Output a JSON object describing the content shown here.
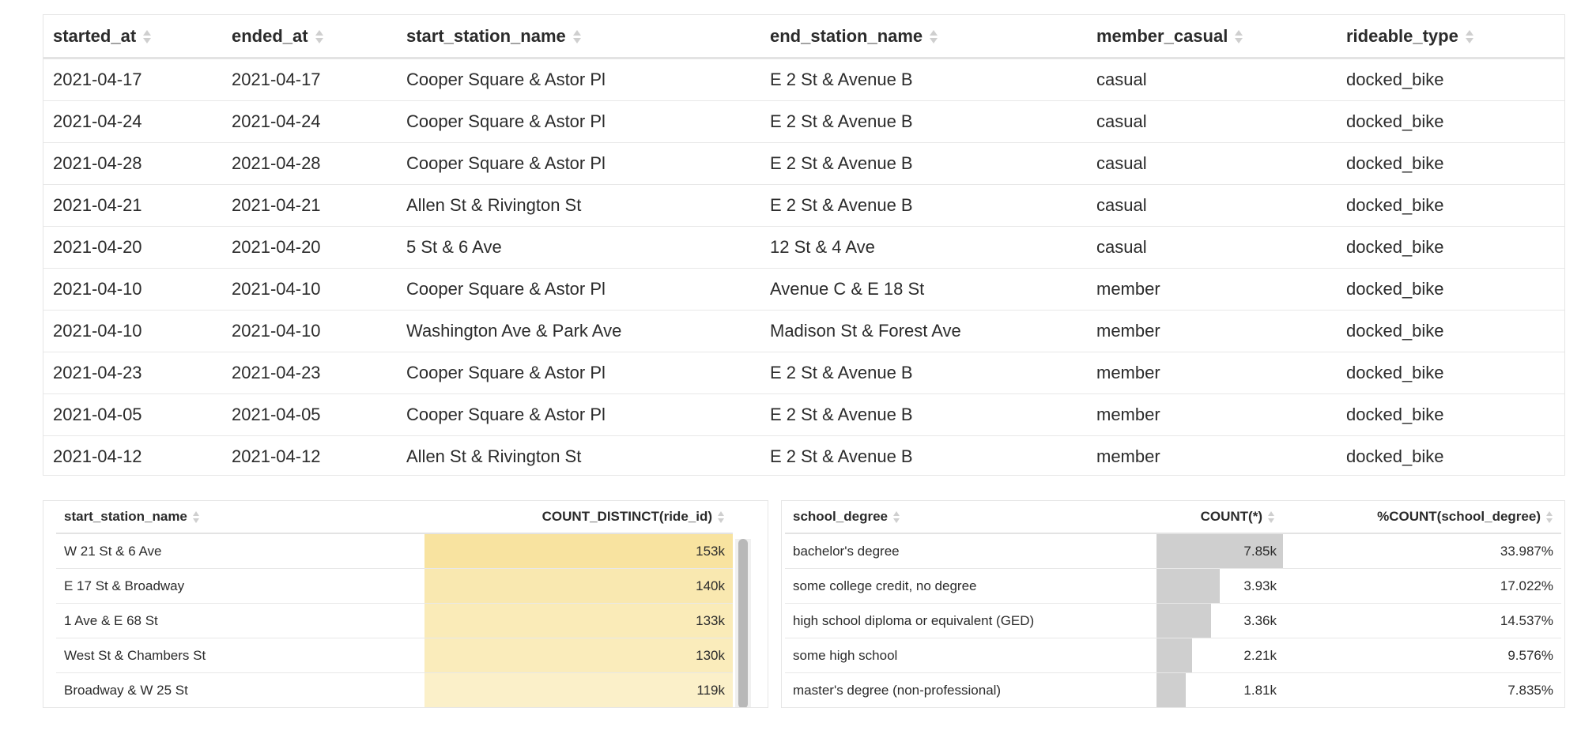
{
  "rides_table": {
    "columns": [
      "started_at",
      "ended_at",
      "start_station_name",
      "end_station_name",
      "member_casual",
      "rideable_type"
    ],
    "rows": [
      [
        "2021-04-17",
        "2021-04-17",
        "Cooper Square & Astor Pl",
        "E 2 St & Avenue B",
        "casual",
        "docked_bike"
      ],
      [
        "2021-04-24",
        "2021-04-24",
        "Cooper Square & Astor Pl",
        "E 2 St & Avenue B",
        "casual",
        "docked_bike"
      ],
      [
        "2021-04-28",
        "2021-04-28",
        "Cooper Square & Astor Pl",
        "E 2 St & Avenue B",
        "casual",
        "docked_bike"
      ],
      [
        "2021-04-21",
        "2021-04-21",
        "Allen St & Rivington St",
        "E 2 St & Avenue B",
        "casual",
        "docked_bike"
      ],
      [
        "2021-04-20",
        "2021-04-20",
        "5 St & 6 Ave",
        "12 St & 4 Ave",
        "casual",
        "docked_bike"
      ],
      [
        "2021-04-10",
        "2021-04-10",
        "Cooper Square & Astor Pl",
        "Avenue C & E 18 St",
        "member",
        "docked_bike"
      ],
      [
        "2021-04-10",
        "2021-04-10",
        "Washington Ave & Park Ave",
        "Madison St & Forest Ave",
        "member",
        "docked_bike"
      ],
      [
        "2021-04-23",
        "2021-04-23",
        "Cooper Square & Astor Pl",
        "E 2 St & Avenue B",
        "member",
        "docked_bike"
      ],
      [
        "2021-04-05",
        "2021-04-05",
        "Cooper Square & Astor Pl",
        "E 2 St & Avenue B",
        "member",
        "docked_bike"
      ],
      [
        "2021-04-12",
        "2021-04-12",
        "Allen St & Rivington St",
        "E 2 St & Avenue B",
        "member",
        "docked_bike"
      ]
    ]
  },
  "station_counts": {
    "columns": [
      "start_station_name",
      "COUNT_DISTINCT(ride_id)"
    ],
    "rows": [
      {
        "name": "W 21 St & 6 Ave",
        "value": "153k",
        "fill": 1.0,
        "color": "#f8e3a0"
      },
      {
        "name": "E 17 St & Broadway",
        "value": "140k",
        "fill": 1.0,
        "color": "#f9e8b0"
      },
      {
        "name": "1 Ave & E 68 St",
        "value": "133k",
        "fill": 1.0,
        "color": "#faebb8"
      },
      {
        "name": "West St & Chambers St",
        "value": "130k",
        "fill": 1.0,
        "color": "#faecbb"
      },
      {
        "name": "Broadway & W 25 St",
        "value": "119k",
        "fill": 1.0,
        "color": "#fbf0c9"
      }
    ]
  },
  "degree_counts": {
    "columns": [
      "school_degree",
      "COUNT(*)",
      "%COUNT(school_degree)"
    ],
    "rows": [
      {
        "name": "bachelor's degree",
        "count": "7.85k",
        "pct": "33.987%",
        "fill": 1.0
      },
      {
        "name": "some college credit, no degree",
        "count": "3.93k",
        "pct": "17.022%",
        "fill": 0.5
      },
      {
        "name": "high school diploma or equivalent (GED)",
        "count": "3.36k",
        "pct": "14.537%",
        "fill": 0.43
      },
      {
        "name": "some high school",
        "count": "2.21k",
        "pct": "9.576%",
        "fill": 0.28
      },
      {
        "name": "master's degree (non-professional)",
        "count": "1.81k",
        "pct": "7.835%",
        "fill": 0.23
      }
    ]
  }
}
